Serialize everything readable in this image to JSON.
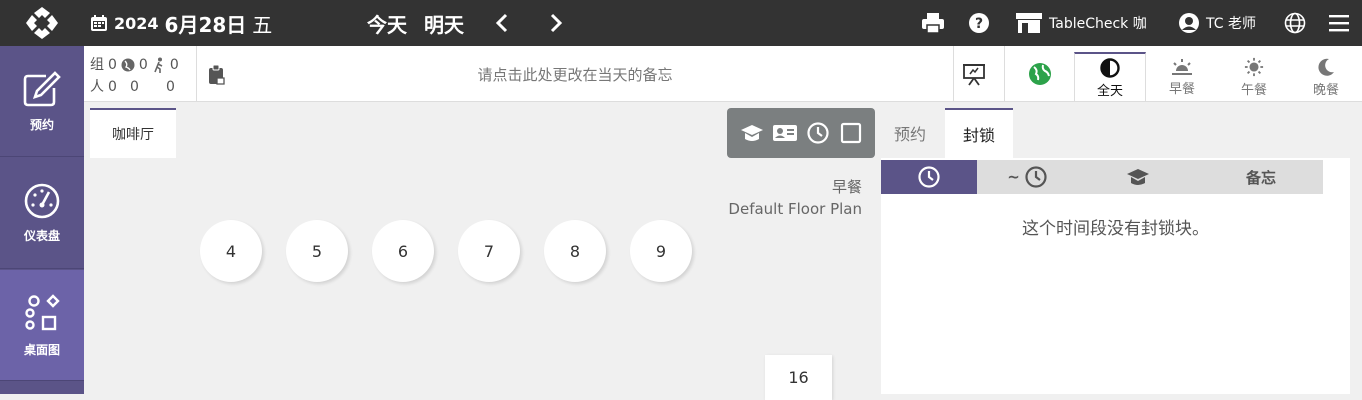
{
  "header": {
    "date_year": "2024",
    "date_main": "6月28日",
    "date_dow": "五",
    "today_label": "今天",
    "tomorrow_label": "明天",
    "store_name": "TableCheck 咖",
    "user_name": "TC 老师"
  },
  "sidebar": {
    "items": [
      {
        "label": "预约",
        "icon": "edit-icon"
      },
      {
        "label": "仪表盘",
        "icon": "gauge-icon"
      },
      {
        "label": "桌面图",
        "icon": "shapes-icon"
      }
    ]
  },
  "counts": {
    "group_label": "组",
    "group_total": "0",
    "group_web": "0",
    "group_walkin": "0",
    "people_label": "人",
    "people_total": "0",
    "people_web": "0",
    "people_walkin": "0"
  },
  "memo": {
    "placeholder": "请点击此处更改在当天的备忘"
  },
  "meals": [
    {
      "label": "全天",
      "icon": "half-circle-icon"
    },
    {
      "label": "早餐",
      "icon": "sunrise-icon"
    },
    {
      "label": "午餐",
      "icon": "sun-icon"
    },
    {
      "label": "晚餐",
      "icon": "moon-icon"
    }
  ],
  "floor": {
    "tab_label": "咖啡厅",
    "meal_label": "早餐",
    "plan_name": "Default Floor Plan",
    "tables": [
      "4",
      "5",
      "6",
      "7",
      "8",
      "9"
    ],
    "square_table": "16"
  },
  "right_panel": {
    "tabs": [
      "预约",
      "封锁"
    ],
    "columns": {
      "until": "~",
      "memo": "备忘"
    },
    "empty_message": "这个时间段没有封锁块。"
  },
  "colors": {
    "accent": "#5b5488",
    "topbar": "#333333",
    "globe": "#2ca24a"
  }
}
